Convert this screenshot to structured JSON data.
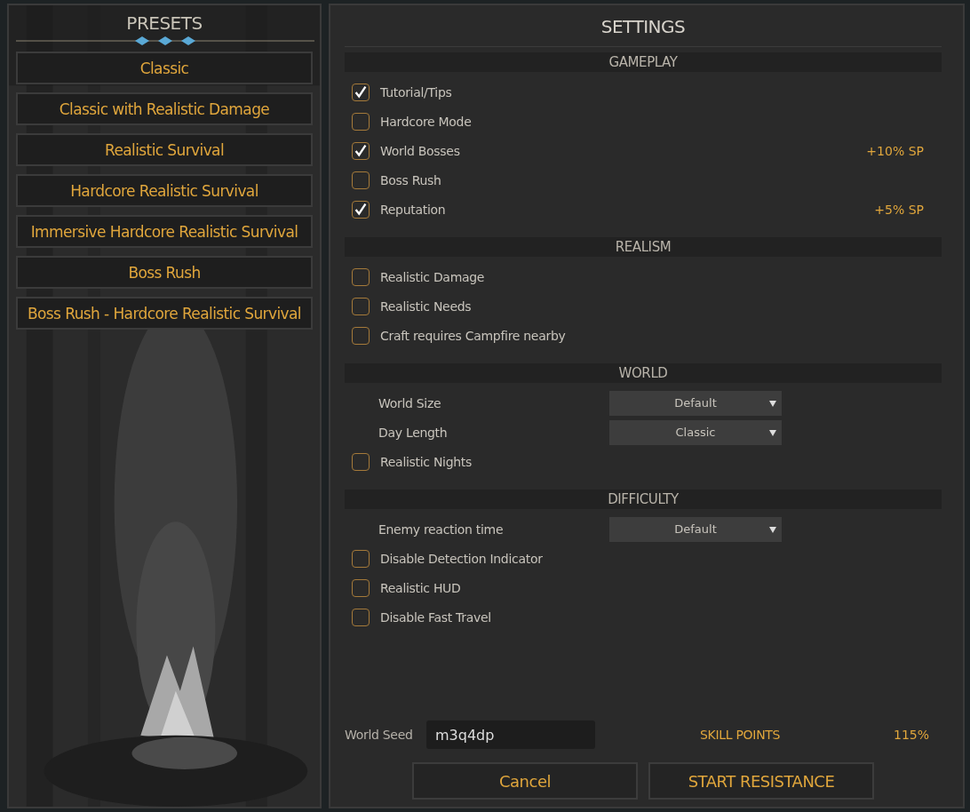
{
  "presets": {
    "title": "PRESETS",
    "items": [
      {
        "label": "Classic"
      },
      {
        "label": "Classic with Realistic Damage"
      },
      {
        "label": "Realistic Survival"
      },
      {
        "label": "Hardcore Realistic Survival"
      },
      {
        "label": "Immersive Hardcore Realistic Survival"
      },
      {
        "label": "Boss Rush"
      },
      {
        "label": "Boss Rush - Hardcore Realistic Survival"
      }
    ]
  },
  "settings": {
    "title": "SETTINGS",
    "sections": [
      {
        "title": "GAMEPLAY",
        "items": [
          {
            "kind": "checkbox",
            "label": "Tutorial/Tips",
            "checked": true
          },
          {
            "kind": "checkbox",
            "label": "Hardcore Mode",
            "checked": false
          },
          {
            "kind": "checkbox",
            "label": "World Bosses",
            "checked": true,
            "bonus": "+10% SP"
          },
          {
            "kind": "checkbox",
            "label": "Boss Rush",
            "checked": false
          },
          {
            "kind": "checkbox",
            "label": "Reputation",
            "checked": true,
            "bonus": "+5% SP"
          }
        ]
      },
      {
        "title": "REALISM",
        "items": [
          {
            "kind": "checkbox",
            "label": "Realistic Damage",
            "checked": false
          },
          {
            "kind": "checkbox",
            "label": "Realistic Needs",
            "checked": false
          },
          {
            "kind": "checkbox",
            "label": "Craft requires Campfire nearby",
            "checked": false
          }
        ]
      },
      {
        "title": "WORLD",
        "items": [
          {
            "kind": "dropdown",
            "label": "World Size",
            "value": "Default"
          },
          {
            "kind": "dropdown",
            "label": "Day Length",
            "value": "Classic"
          },
          {
            "kind": "checkbox",
            "label": "Realistic Nights",
            "checked": false
          }
        ]
      },
      {
        "title": "DIFFICULTY",
        "items": [
          {
            "kind": "dropdown",
            "label": "Enemy reaction time",
            "value": "Default"
          },
          {
            "kind": "checkbox",
            "label": "Disable Detection Indicator",
            "checked": false
          },
          {
            "kind": "checkbox",
            "label": "Realistic HUD",
            "checked": false
          },
          {
            "kind": "checkbox",
            "label": "Disable Fast Travel",
            "checked": false
          }
        ]
      }
    ],
    "seed": {
      "label": "World Seed",
      "value": "m3q4dp"
    },
    "skill_points": {
      "label": "SKILL POINTS",
      "value": "115%"
    },
    "buttons": [
      "Cancel",
      "START RESISTANCE"
    ]
  }
}
